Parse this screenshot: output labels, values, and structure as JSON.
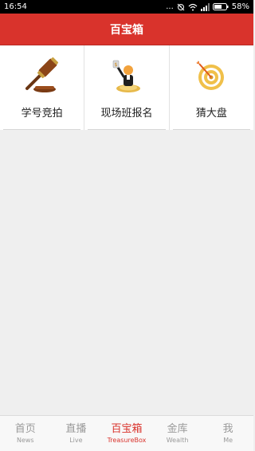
{
  "status": {
    "time": "16:54",
    "dots": "...",
    "battery": "58%"
  },
  "header": {
    "title": "百宝箱"
  },
  "grid": [
    {
      "label": "学号竞拍",
      "icon": "gavel-icon"
    },
    {
      "label": "现场班报名",
      "icon": "presenter-icon"
    },
    {
      "label": "猜大盘",
      "icon": "target-icon"
    }
  ],
  "tabs": [
    {
      "zh": "首页",
      "en": "News"
    },
    {
      "zh": "直播",
      "en": "Live"
    },
    {
      "zh": "百宝箱",
      "en": "TreasureBox"
    },
    {
      "zh": "金库",
      "en": "Wealth"
    },
    {
      "zh": "我",
      "en": "Me"
    }
  ],
  "colors": {
    "accent": "#d9332c",
    "tab_inactive": "#9a9a9a"
  }
}
